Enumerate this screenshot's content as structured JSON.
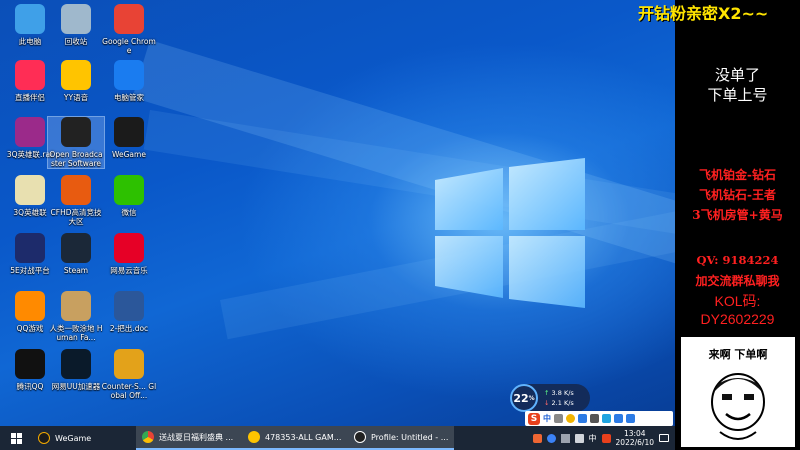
{
  "desktop": {
    "icons": [
      {
        "label": "此电脑",
        "icon": "computer-icon",
        "color": "#3fa0e8"
      },
      {
        "label": "回收站",
        "icon": "recycle-bin-icon",
        "color": "#9fb8cc"
      },
      {
        "label": "Google Chrome",
        "icon": "chrome-icon",
        "color": "#e84335"
      },
      {
        "label": "直播伴侣",
        "icon": "live-companion-icon",
        "color": "#ff2d55"
      },
      {
        "label": "YY语音",
        "icon": "yy-voice-icon",
        "color": "#ffc400"
      },
      {
        "label": "电脑管家",
        "icon": "pc-manager-icon",
        "color": "#1a7cf0"
      },
      {
        "label": "3Q英雄联.rar",
        "icon": "rar-archive-icon",
        "color": "#9b2a8a"
      },
      {
        "label": "Open Broadcaster Software",
        "icon": "obs-icon",
        "color": "#222222"
      },
      {
        "label": "WeGame",
        "icon": "wegame-icon",
        "color": "#1b1b1b"
      },
      {
        "label": "3Q英雄联",
        "icon": "document-icon",
        "color": "#e8e0b0"
      },
      {
        "label": "CFHD高清竞技大区",
        "icon": "cfhd-icon",
        "color": "#e85b10"
      },
      {
        "label": "微信",
        "icon": "wechat-icon",
        "color": "#2dc100"
      },
      {
        "label": "5E对战平台",
        "icon": "5e-platform-icon",
        "color": "#1d2b6b"
      },
      {
        "label": "Steam",
        "icon": "steam-icon",
        "color": "#1b2838"
      },
      {
        "label": "网易云音乐",
        "icon": "netease-music-icon",
        "color": "#e60026"
      },
      {
        "label": "QQ游戏",
        "icon": "qq-game-icon",
        "color": "#ff8a00"
      },
      {
        "label": "人类一败涂地 Human Fa...",
        "icon": "human-fall-flat-icon",
        "color": "#c8a060"
      },
      {
        "label": "2-把出.doc",
        "icon": "word-doc-icon",
        "color": "#2b579a"
      },
      {
        "label": "腾讯QQ",
        "icon": "qq-icon",
        "color": "#111111"
      },
      {
        "label": "网易UU加速器",
        "icon": "uu-accelerator-icon",
        "color": "#0a1a2a"
      },
      {
        "label": "Counter-S... Global Off...",
        "icon": "csgo-icon",
        "color": "#e3a21a"
      }
    ]
  },
  "net_widget": {
    "percent": "22",
    "unit": "%",
    "up": "3.8",
    "down": "2.1",
    "speed_unit": "K/s"
  },
  "ime": {
    "logo": "S",
    "mode": "中"
  },
  "taskbar": {
    "items": [
      {
        "label": "WeGame",
        "icon": "wegame-icon"
      },
      {
        "label": "送战夏日福利盛典 ...",
        "icon": "chrome-icon"
      },
      {
        "label": "478353-ALL GAM...",
        "icon": "yy-voice-icon"
      },
      {
        "label": "Profile: Untitled - ...",
        "icon": "obs-icon"
      }
    ],
    "tray_lang": "中",
    "time": "13:04",
    "date": "2022/6/10"
  },
  "overlay": {
    "banner": "开钻粉亲密X2~~",
    "status_line1": "没单了",
    "status_line2": "下单上号",
    "services": [
      "飞机铂金-钻石",
      "飞机钻石-王者",
      "3飞机房管+黄马"
    ],
    "qv": "QV:  9184224",
    "group": "加交流群私聊我",
    "kol_label": "KOL码:",
    "kol_code": "DY2602229",
    "meme_caption": "来啊 下单啊"
  }
}
